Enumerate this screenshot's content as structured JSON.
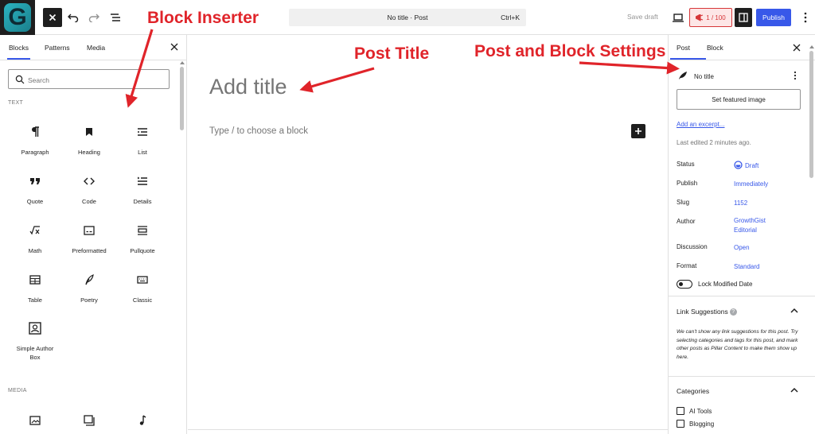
{
  "topbar": {
    "logo_letter": "G",
    "document_title": "No title · Post",
    "shortcut": "Ctrl+K",
    "save_draft": "Save draft",
    "counter": "1 / 100",
    "publish": "Publish"
  },
  "annotations": {
    "block_inserter": "Block Inserter",
    "post_title": "Post Title",
    "post_block_settings": "Post and Block Settings",
    "arrow_color": "#e0242a"
  },
  "inserter": {
    "tabs": [
      "Blocks",
      "Patterns",
      "Media"
    ],
    "search_placeholder": "Search",
    "text_category": "TEXT",
    "media_category": "MEDIA",
    "blocks": [
      {
        "label": "Paragraph",
        "icon": "paragraph-icon"
      },
      {
        "label": "Heading",
        "icon": "heading-icon"
      },
      {
        "label": "List",
        "icon": "list-icon"
      },
      {
        "label": "Quote",
        "icon": "quote-icon"
      },
      {
        "label": "Code",
        "icon": "code-icon"
      },
      {
        "label": "Details",
        "icon": "details-icon"
      },
      {
        "label": "Math",
        "icon": "math-icon"
      },
      {
        "label": "Preformatted",
        "icon": "preformatted-icon"
      },
      {
        "label": "Pullquote",
        "icon": "pullquote-icon"
      },
      {
        "label": "Table",
        "icon": "table-icon"
      },
      {
        "label": "Poetry",
        "icon": "poetry-icon"
      },
      {
        "label": "Classic",
        "icon": "classic-icon"
      },
      {
        "label": "Simple Author Box",
        "icon": "author-box-icon"
      }
    ],
    "media_icons": [
      "image-icon",
      "gallery-icon",
      "audio-icon"
    ]
  },
  "canvas": {
    "title_placeholder": "Add title",
    "block_placeholder": "Type / to choose a block"
  },
  "settings": {
    "tabs": [
      "Post",
      "Block"
    ],
    "post_name": "No title",
    "featured_image": "Set featured image",
    "excerpt": "Add an excerpt...",
    "last_edited": "Last edited 2 minutes ago.",
    "rows": [
      {
        "key": "Status",
        "value": "Draft"
      },
      {
        "key": "Publish",
        "value": "Immediately"
      },
      {
        "key": "Slug",
        "value": "1152"
      },
      {
        "key": "Author",
        "value": "GrowthGist Editorial"
      },
      {
        "key": "Discussion",
        "value": "Open"
      },
      {
        "key": "Format",
        "value": "Standard"
      }
    ],
    "lock_modified": "Lock Modified Date",
    "link_suggestions_title": "Link Suggestions",
    "link_suggestions_note": "We can't show any link suggestions for this post. Try selecting categories and tags for this post, and mark other posts as Pillar Content to make them show up here.",
    "categories_title": "Categories",
    "categories": [
      "AI Tools",
      "Blogging"
    ],
    "accent_color": "#3858e9"
  }
}
